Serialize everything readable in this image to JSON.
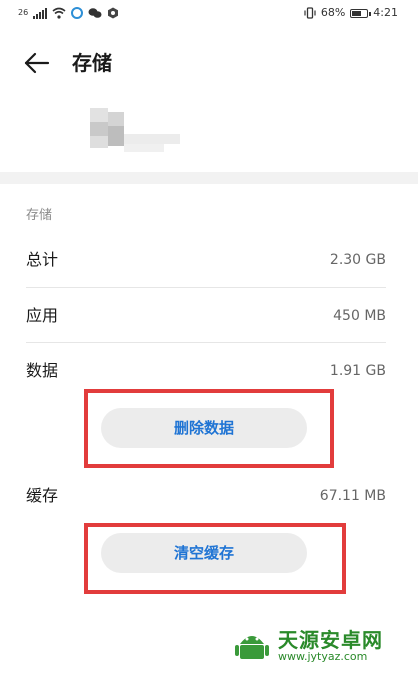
{
  "status_bar": {
    "network": "26",
    "battery_text": "68%",
    "battery_level": 0.68,
    "time": "4:21"
  },
  "header": {
    "title": "存储"
  },
  "storage": {
    "section_label": "存储",
    "rows": [
      {
        "label": "总计",
        "value": "2.30 GB"
      },
      {
        "label": "应用",
        "value": "450 MB"
      },
      {
        "label": "数据",
        "value": "1.91 GB"
      }
    ],
    "delete_data_label": "删除数据",
    "cache": {
      "label": "缓存",
      "value": "67.11 MB"
    },
    "clear_cache_label": "清空缓存"
  },
  "watermark": {
    "name": "天源安卓网",
    "url": "www.jytyaz.com"
  },
  "colors": {
    "accent": "#1f74d4",
    "highlight": "#e23c3c",
    "watermark": "#2a8a2a"
  }
}
